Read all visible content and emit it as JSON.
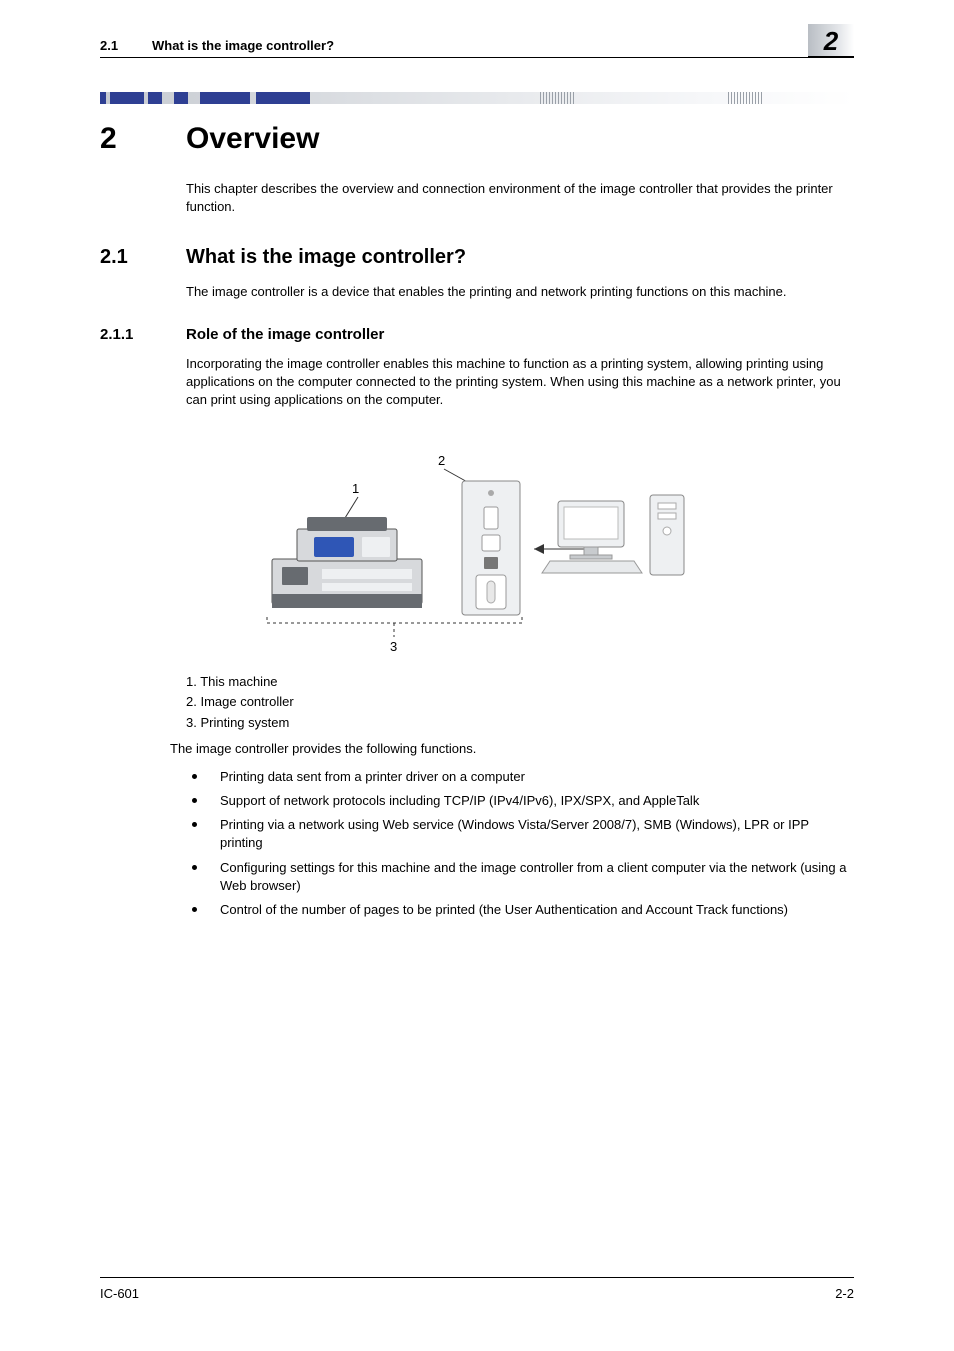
{
  "header": {
    "section_number": "2.1",
    "section_title": "What is the image controller?",
    "chapter_number_badge": "2"
  },
  "chapter": {
    "number": "2",
    "title": "Overview",
    "intro": "This chapter describes the overview and connection environment of the image controller that provides the printer function."
  },
  "section": {
    "number": "2.1",
    "title": "What is the image controller?",
    "text": "The image controller is a device that enables the printing and network printing functions on this machine."
  },
  "subsection": {
    "number": "2.1.1",
    "title": "Role of the image controller",
    "text": "Incorporating the image controller enables this machine to function as a printing system, allowing printing using applications on the computer connected to the printing system. When using this machine as a network printer, you can print using applications on the computer."
  },
  "figure": {
    "labels": {
      "l1": "1",
      "l2": "2",
      "l3": "3"
    },
    "legend": {
      "i1": "1. This machine",
      "i2": "2. Image controller",
      "i3": "3. Printing system"
    }
  },
  "functions_intro": "The image controller provides the following functions.",
  "bullets": [
    "Printing data sent from a printer driver on a computer",
    "Support of network protocols including TCP/IP (IPv4/IPv6), IPX/SPX, and AppleTalk",
    "Printing via a network using Web service (Windows Vista/Server 2008/7), SMB (Windows), LPR or IPP printing",
    "Configuring settings for this machine and the image controller from a client computer via the network (using a Web browser)",
    "Control of the number of pages to be printed (the User Authentication and Account Track functions)"
  ],
  "footer": {
    "left": "IC-601",
    "right": "2-2"
  }
}
